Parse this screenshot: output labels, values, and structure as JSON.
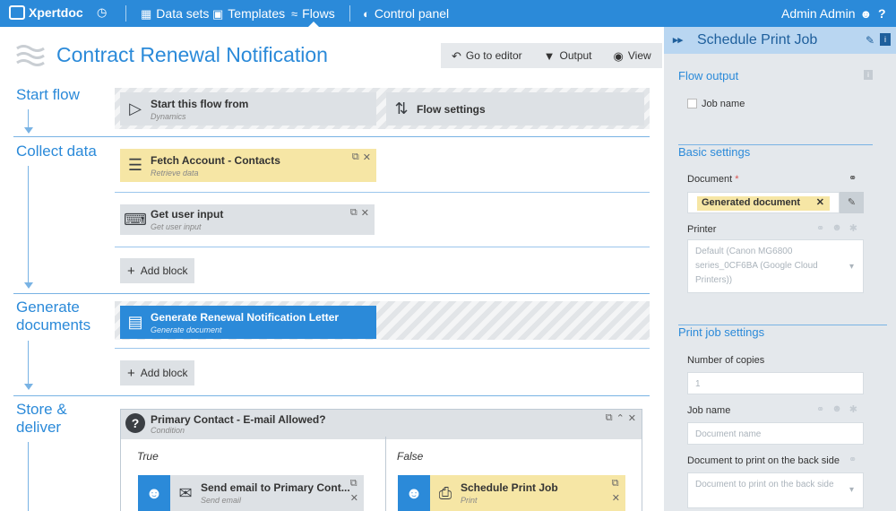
{
  "nav": {
    "brand": "Xpertdoc",
    "items": [
      {
        "label": "Data sets",
        "icon": "datasets-icon"
      },
      {
        "label": "Templates",
        "icon": "templates-icon"
      },
      {
        "label": "Flows",
        "icon": "flows-icon"
      },
      {
        "label": "Control panel",
        "icon": "control-panel-icon"
      }
    ],
    "user": "Admin Admin",
    "accent": "#2b8ad9"
  },
  "header": {
    "title": "Contract Renewal Notification",
    "buttons": [
      "Go to editor",
      "Output",
      "View"
    ]
  },
  "sections": {
    "start": "Start flow",
    "collect": "Collect data",
    "generate": "Generate documents",
    "store": "Store & deliver"
  },
  "blocks": {
    "start_from": {
      "title": "Start this flow from",
      "subtitle": "Dynamics"
    },
    "flow_settings": {
      "title": "Flow settings"
    },
    "fetch": {
      "title": "Fetch Account - Contacts",
      "subtitle": "Retrieve data"
    },
    "user_input": {
      "title": "Get user input",
      "subtitle": "Get user input"
    },
    "generate": {
      "title": "Generate Renewal Notification Letter",
      "subtitle": "Generate document"
    },
    "condition": {
      "title": "Primary Contact - E-mail Allowed?",
      "subtitle": "Condition"
    },
    "send_email": {
      "title": "Send email to Primary Cont...",
      "subtitle": "Send email"
    },
    "print_job": {
      "title": "Schedule Print Job",
      "subtitle": "Print"
    }
  },
  "add_block": "Add block",
  "branches": {
    "true": "True",
    "false": "False"
  },
  "panel": {
    "title": "Schedule Print Job",
    "flow_output": "Flow output",
    "job_name_checkbox": "Job name",
    "basic_settings": "Basic settings",
    "document_label": "Document",
    "required_mark": "*",
    "document_value": "Generated document",
    "printer_label": "Printer",
    "printer_value": "Default (Canon MG6800 series_0CF6BA (Google Cloud Printers))",
    "print_job_settings": "Print job settings",
    "copies_label": "Number of copies",
    "copies_placeholder": "1",
    "job_name_label": "Job name",
    "job_name_placeholder": "Document name",
    "back_side_label": "Document to print on the back side",
    "back_side_placeholder": "Document to print on the back side"
  }
}
